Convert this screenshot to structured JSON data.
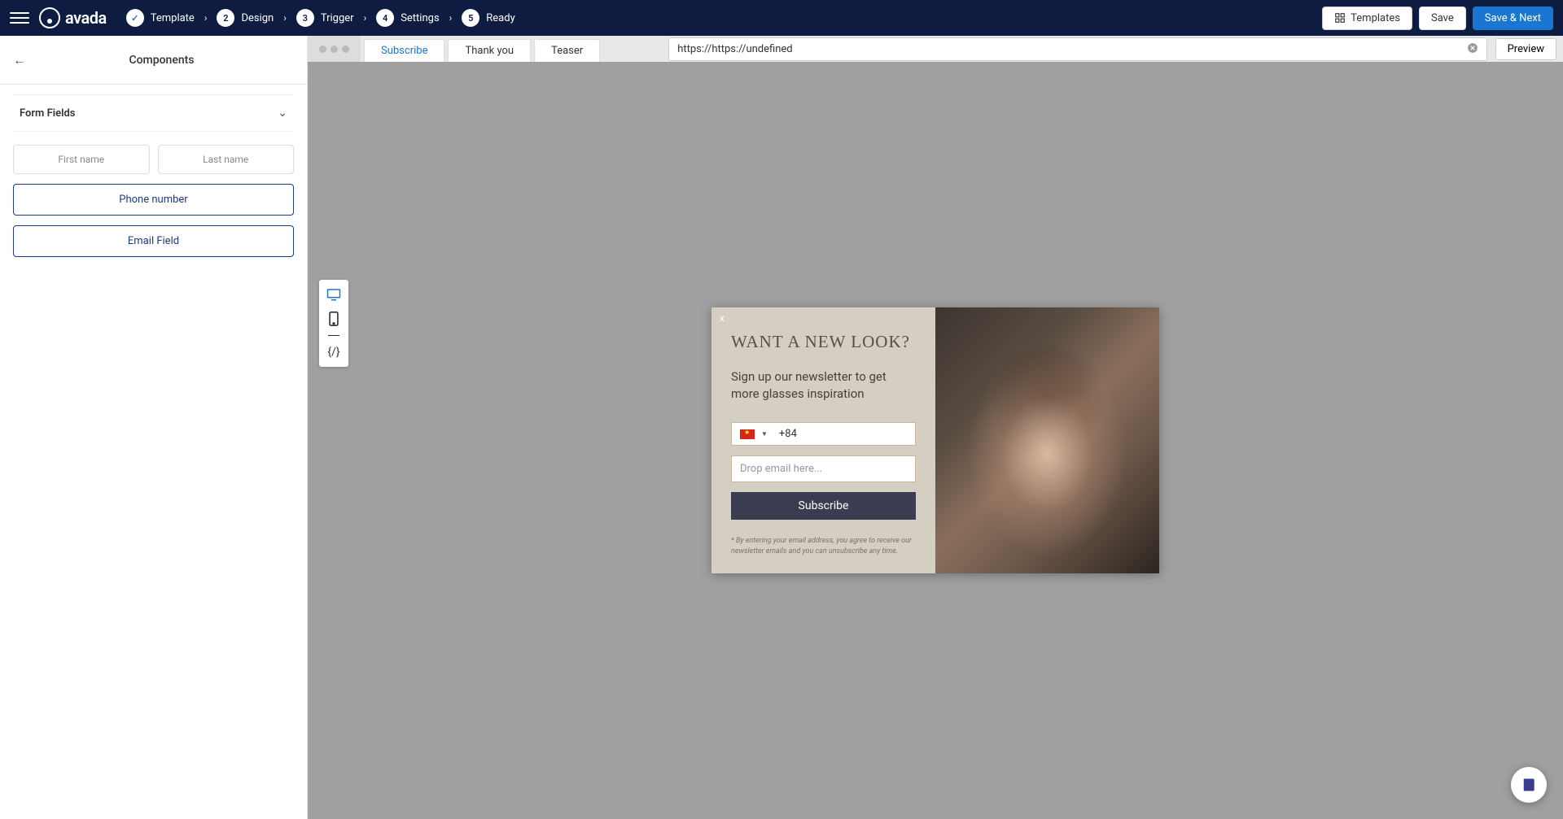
{
  "brand": "avada",
  "steps": [
    {
      "num": "✓",
      "label": "Template",
      "done": true
    },
    {
      "num": "2",
      "label": "Design",
      "done": false
    },
    {
      "num": "3",
      "label": "Trigger",
      "done": false
    },
    {
      "num": "4",
      "label": "Settings",
      "done": false
    },
    {
      "num": "5",
      "label": "Ready",
      "done": false
    }
  ],
  "topbar": {
    "templates": "Templates",
    "save": "Save",
    "save_next": "Save & Next"
  },
  "sidebar": {
    "title": "Components",
    "section": "Form Fields",
    "fields": {
      "first_name": "First name",
      "last_name": "Last name",
      "phone": "Phone number",
      "email": "Email Field"
    }
  },
  "canvas": {
    "tabs": [
      "Subscribe",
      "Thank you",
      "Teaser"
    ],
    "active_tab": 0,
    "url": "https://https://undefined",
    "preview": "Preview"
  },
  "popup": {
    "close": "x",
    "title": "WANT A NEW LOOK?",
    "subtitle": "Sign up our newsletter to get more glasses inspiration",
    "phone_code": "+84",
    "email_placeholder": "Drop email here...",
    "button": "Subscribe",
    "disclaimer": "* By entering your email address, you agree to receive our newsletter emails and you can unsubscribe any time."
  }
}
